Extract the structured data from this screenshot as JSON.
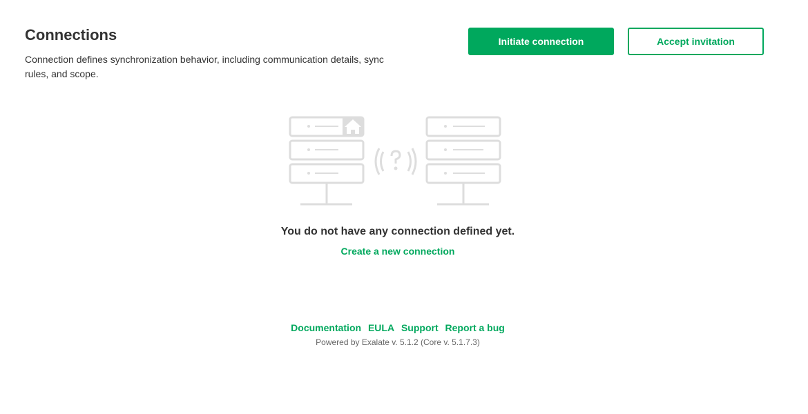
{
  "header": {
    "title": "Connections",
    "description": "Connection defines synchronization behavior, including communication details, sync rules, and scope."
  },
  "actions": {
    "initiate_label": "Initiate connection",
    "accept_label": "Accept invitation"
  },
  "empty_state": {
    "illustration_icon": "servers-connection-question-icon",
    "message": "You do not have any connection defined yet.",
    "create_link_label": "Create a new connection"
  },
  "footer": {
    "links": [
      "Documentation",
      "EULA",
      "Support",
      "Report a bug"
    ],
    "powered_by": "Powered by Exalate v. 5.1.2 (Core v. 5.1.7.3)"
  },
  "colors": {
    "accent": "#00a85d",
    "illustration": "#dddddd"
  }
}
